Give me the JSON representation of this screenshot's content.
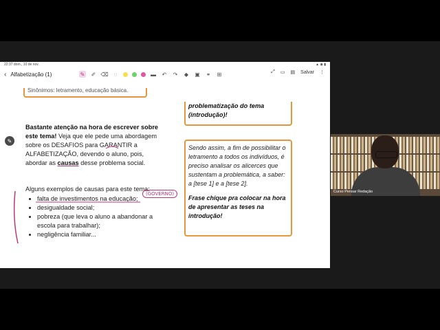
{
  "status_bar": {
    "time": "22:37",
    "date": "dom., 10 de nov.",
    "icons": "signal wifi battery"
  },
  "app_bar": {
    "back_icon": "back-arrow-icon",
    "title": "Alfabetização (1)",
    "save_label": "Salvar",
    "colors": [
      "#f4e04d",
      "#6fd16f",
      "#e056a0"
    ]
  },
  "left_column": {
    "top_box_text": "Sinônimos: letramento, educação básica.",
    "paragraph_bold": "Bastante atenção na hora de escrever sobre este tema!",
    "paragraph_rest": " Veja que ele pede uma abordagem sobre os DESAFIOS para GARANTIR a ALFABETIZAÇÃO, devendo o aluno, pois, abordar as ",
    "paragraph_causas": "causas",
    "paragraph_end": " desse problema social.",
    "list_title": "Alguns exemplos de causas para este tema:",
    "items": [
      "falta de investimentos na educação;",
      "desigualdade social;",
      "pobreza (que leva o aluno a abandonar a escola para trabalhar);",
      "negligência familiar..."
    ],
    "annotation": "(GOVERNO)"
  },
  "right_column": {
    "box1_text": "problematização do tema (introdução)!",
    "box2_text": "Sendo assim, a fim de possibilitar o letramento a todos os indivíduos, é preciso analisar os alicerces que sustentam a problemática, a saber: a [tese 1] e a [tese 2].",
    "box2_bold": "Frase chique pra colocar na hora de apresentar as teses na introdução!"
  },
  "webcam": {
    "label": "Curso Pensar Redação"
  }
}
